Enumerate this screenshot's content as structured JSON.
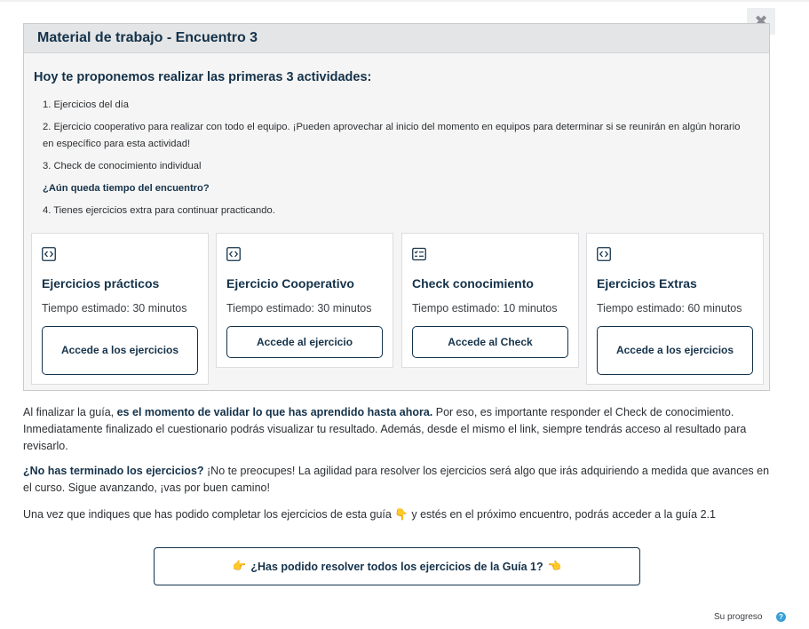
{
  "modal": {
    "close_label": "✖",
    "title": "Material de trabajo - Encuentro 3",
    "intro": "Hoy te proponemos realizar las primeras 3 actividades:",
    "steps": [
      "1. Ejercicios del día",
      "2. Ejercicio cooperativo para realizar con todo el equipo. ¡Pueden aprovechar al inicio del momento en equipos para determinar si se reunirán en algún horario en específico para esta actividad!",
      "3. Check de conocimiento individual",
      "¿Aún queda tiempo del encuentro?",
      "4. Tienes ejercicios extra para continuar practicando."
    ],
    "cards": [
      {
        "icon": "code-icon",
        "title": "Ejercicios prácticos",
        "time": "Tiempo estimado: 30 minutos",
        "button": "Accede a los ejercicios"
      },
      {
        "icon": "code-icon",
        "title": "Ejercicio Cooperativo",
        "time": "Tiempo estimado: 30 minutos",
        "button": "Accede al ejercicio"
      },
      {
        "icon": "checklist-icon",
        "title": "Check conocimiento",
        "time": "Tiempo estimado: 10 minutos",
        "button": "Accede al Check"
      },
      {
        "icon": "code-icon",
        "title": "Ejercicios Extras",
        "time": "Tiempo estimado: 60 minutos",
        "button": "Accede a los ejercicios"
      }
    ]
  },
  "body": {
    "p1_a": "Al finalizar la guía, ",
    "p1_b": "es el momento de validar lo que has aprendido hasta ahora.",
    "p1_c": " Por eso, es importante responder el Check de conocimiento. Inmediatamente finalizado el cuestionario podrás visualizar tu resultado. Además, desde el mismo el link, siempre tendrás acceso al resultado para revisarlo.",
    "p2_a": "¿No has terminado los ejercicios?",
    "p2_b": " ¡No te preocupes! La agilidad para resolver los ejercicios será algo que irás adquiriendo a medida que avances en el curso. Sigue avanzando, ¡vas por buen camino!",
    "p3_a": "Una vez que indiques que has podido completar los ejercicios de esta guía ",
    "p3_emoji": "👇",
    "p3_b": " y estés en el próximo encuentro, podrás acceder a la guía 2.1",
    "cta_left_emoji": "👉",
    "cta_label": "¿Has podido resolver todos los ejercicios de la Guía 1?",
    "cta_right_emoji": "👈"
  },
  "footer": {
    "progress_label": "Su progreso",
    "help_label": "?"
  },
  "colors": {
    "primary": "#14324a",
    "help": "#39a0d6"
  }
}
